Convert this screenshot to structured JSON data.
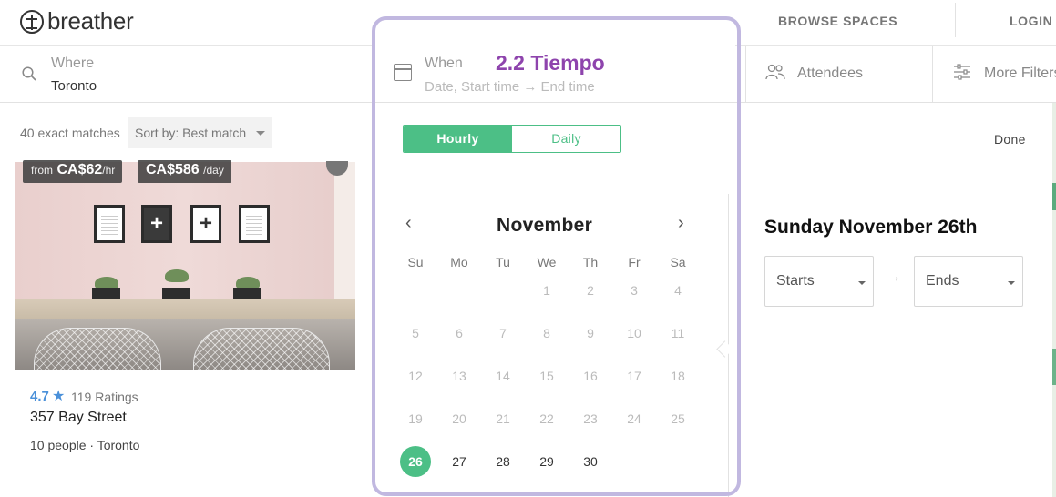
{
  "header": {
    "logo_text": "breather",
    "nav_browse": "BROWSE SPACES",
    "nav_login": "LOGIN"
  },
  "search": {
    "where_label": "Where",
    "where_value": "Toronto",
    "when_label": "When",
    "when_placeholder": "Date, Start time → End time",
    "attendees_label": "Attendees",
    "filters_label": "More Filters"
  },
  "annotation": "2.2 Tiempo",
  "results": {
    "matches": "40 exact matches",
    "sort_label": "Sort by:",
    "sort_value": "Best match"
  },
  "card": {
    "badge_hourly_prefix": "from",
    "badge_hourly_price": "CA$62",
    "badge_hourly_unit": "/hr",
    "badge_daily_price": "CA$586",
    "badge_daily_unit": "/day",
    "rating": "4.7",
    "rating_star": "★",
    "ratings_count": "119 Ratings",
    "title": "357 Bay Street",
    "meta": "10 people · Toronto"
  },
  "datepicker": {
    "tabs": [
      {
        "label": "Hourly",
        "active": true
      },
      {
        "label": "Daily",
        "active": false
      }
    ],
    "done_label": "Done",
    "month": "November",
    "prev": "‹",
    "next": "›",
    "weekdays": [
      "Su",
      "Mo",
      "Tu",
      "We",
      "Th",
      "Fr",
      "Sa"
    ],
    "weeks": [
      [
        "",
        "",
        "",
        "1",
        "2",
        "3",
        "4"
      ],
      [
        "5",
        "6",
        "7",
        "8",
        "9",
        "10",
        "11"
      ],
      [
        "12",
        "13",
        "14",
        "15",
        "16",
        "17",
        "18"
      ],
      [
        "19",
        "20",
        "21",
        "22",
        "23",
        "24",
        "25"
      ],
      [
        "26",
        "27",
        "28",
        "29",
        "30",
        "",
        ""
      ]
    ],
    "selected_day": "26",
    "first_available_day": 26,
    "selected_date_heading": "Sunday November 26th",
    "starts_label": "Starts",
    "ends_label": "Ends",
    "range_arrow": "→"
  },
  "colors": {
    "accent_green": "#4cbf86",
    "rating_blue": "#4a90d9",
    "annotation_purple": "#8e44ad",
    "frame_lavender": "#c1b8e0"
  }
}
